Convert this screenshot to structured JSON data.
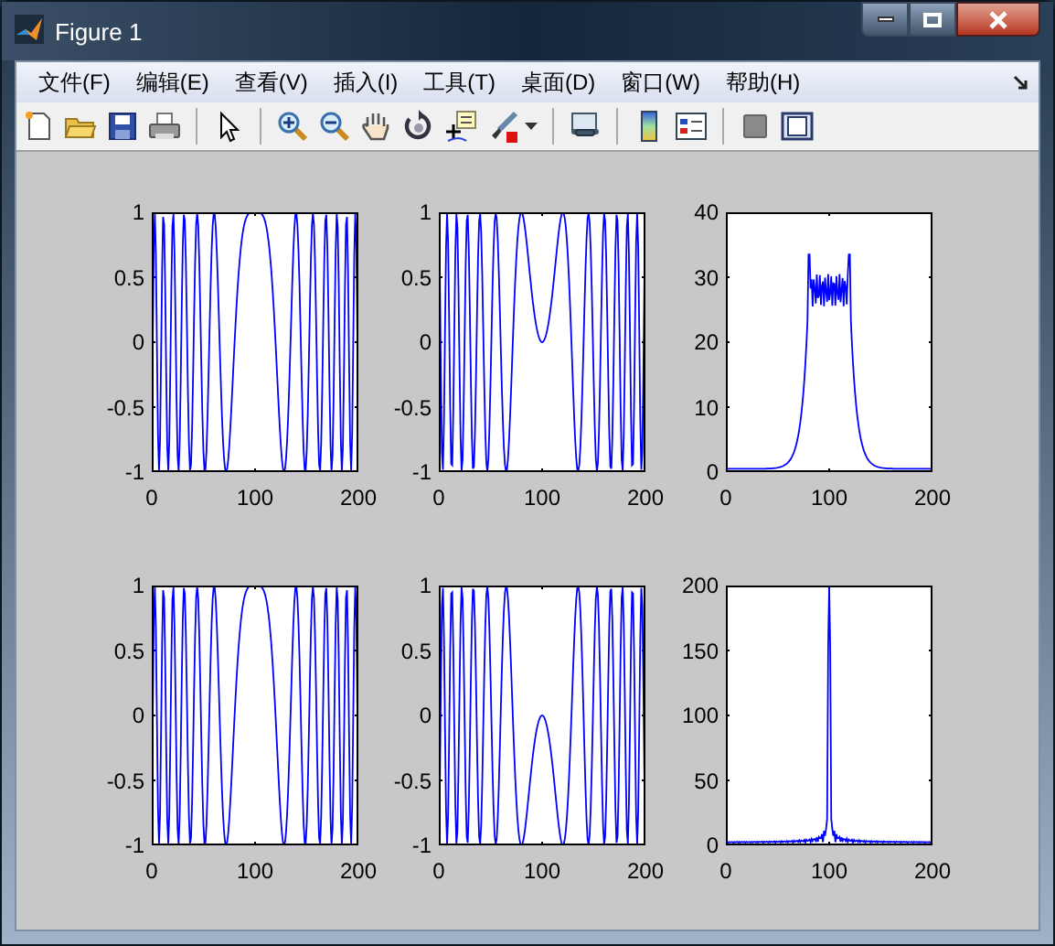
{
  "window": {
    "title": "Figure 1"
  },
  "menu": [
    "文件(F)",
    "编辑(E)",
    "查看(V)",
    "插入(I)",
    "工具(T)",
    "桌面(D)",
    "窗口(W)",
    "帮助(H)"
  ],
  "plots": [
    {
      "kind": "cos_chirp",
      "yticks": [
        "1",
        "0.5",
        "0",
        "-0.5",
        "-1"
      ],
      "xticks": [
        "0",
        "100",
        "200"
      ]
    },
    {
      "kind": "sin_chirp",
      "yticks": [
        "1",
        "0.5",
        "0",
        "-0.5",
        "-1"
      ],
      "xticks": [
        "0",
        "100",
        "200"
      ]
    },
    {
      "kind": "band",
      "yticks": [
        "40",
        "30",
        "20",
        "10",
        "0"
      ],
      "xticks": [
        "0",
        "100",
        "200"
      ]
    },
    {
      "kind": "cos_chirp",
      "yticks": [
        "1",
        "0.5",
        "0",
        "-0.5",
        "-1"
      ],
      "xticks": [
        "0",
        "100",
        "200"
      ]
    },
    {
      "kind": "neg_sin_chirp",
      "yticks": [
        "1",
        "0.5",
        "0",
        "-0.5",
        "-1"
      ],
      "xticks": [
        "0",
        "100",
        "200"
      ]
    },
    {
      "kind": "peak",
      "yticks": [
        "200",
        "150",
        "100",
        "50",
        "0"
      ],
      "xticks": [
        "0",
        "100",
        "200"
      ]
    }
  ]
}
